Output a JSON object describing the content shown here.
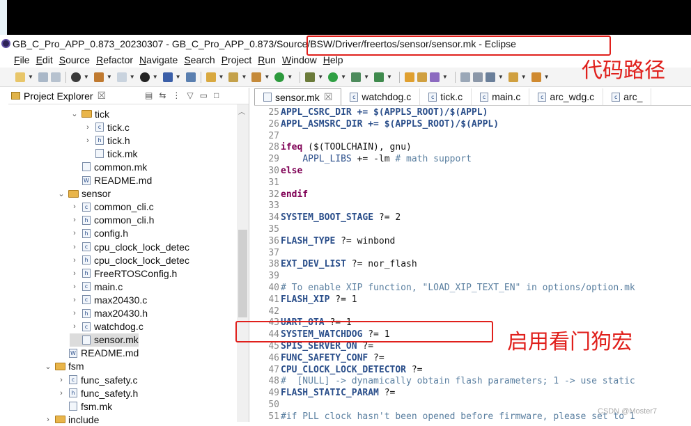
{
  "window": {
    "title": "GB_C_Pro_APP_0.873_20230307 - GB_C_Pro_APP_0.873/Source/BSW/Driver/freertos/sensor/sensor.mk - Eclipse"
  },
  "menu": [
    "File",
    "Edit",
    "Source",
    "Refactor",
    "Navigate",
    "Search",
    "Project",
    "Run",
    "Window",
    "Help"
  ],
  "explorer": {
    "title": "Project Explorer",
    "close": "☒",
    "tree": [
      {
        "label": "tick",
        "kind": "folder",
        "indent": 2,
        "expanded": true
      },
      {
        "label": "tick.c",
        "kind": "c",
        "indent": 3,
        "expanded": false
      },
      {
        "label": "tick.h",
        "kind": "h",
        "indent": 3,
        "expanded": false
      },
      {
        "label": "tick.mk",
        "kind": "mk",
        "indent": 3,
        "expanded": null
      },
      {
        "label": "common.mk",
        "kind": "mk",
        "indent": 2,
        "expanded": null
      },
      {
        "label": "README.md",
        "kind": "md",
        "indent": 2,
        "expanded": null
      },
      {
        "label": "sensor",
        "kind": "folder",
        "indent": 1,
        "expanded": true
      },
      {
        "label": "common_cli.c",
        "kind": "c",
        "indent": 2,
        "expanded": false
      },
      {
        "label": "common_cli.h",
        "kind": "h",
        "indent": 2,
        "expanded": false
      },
      {
        "label": "config.h",
        "kind": "h",
        "indent": 2,
        "expanded": false
      },
      {
        "label": "cpu_clock_lock_detec",
        "kind": "c",
        "indent": 2,
        "expanded": false
      },
      {
        "label": "cpu_clock_lock_detec",
        "kind": "h",
        "indent": 2,
        "expanded": false
      },
      {
        "label": "FreeRTOSConfig.h",
        "kind": "h",
        "indent": 2,
        "expanded": false
      },
      {
        "label": "main.c",
        "kind": "c",
        "indent": 2,
        "expanded": false
      },
      {
        "label": "max20430.c",
        "kind": "c",
        "indent": 2,
        "expanded": false
      },
      {
        "label": "max20430.h",
        "kind": "h",
        "indent": 2,
        "expanded": false
      },
      {
        "label": "watchdog.c",
        "kind": "c",
        "indent": 2,
        "expanded": false
      },
      {
        "label": "sensor.mk",
        "kind": "mk",
        "indent": 2,
        "expanded": null,
        "selected": true
      },
      {
        "label": "README.md",
        "kind": "md",
        "indent": 1,
        "expanded": null
      },
      {
        "label": "fsm",
        "kind": "folder",
        "indent": 0,
        "expanded": true
      },
      {
        "label": "func_safety.c",
        "kind": "c",
        "indent": 1,
        "expanded": false
      },
      {
        "label": "func_safety.h",
        "kind": "h",
        "indent": 1,
        "expanded": false
      },
      {
        "label": "fsm.mk",
        "kind": "mk",
        "indent": 1,
        "expanded": null
      },
      {
        "label": "include",
        "kind": "folder",
        "indent": 0,
        "expanded": false
      }
    ]
  },
  "editor": {
    "tabs": [
      {
        "label": "sensor.mk",
        "active": true,
        "close": "☒"
      },
      {
        "label": "watchdog.c",
        "active": false
      },
      {
        "label": "tick.c",
        "active": false
      },
      {
        "label": "main.c",
        "active": false
      },
      {
        "label": "arc_wdg.c",
        "active": false
      },
      {
        "label": "arc_",
        "active": false
      }
    ],
    "lines": [
      {
        "n": "25",
        "t": "APPL_CSRC_DIR += $(APPLS_ROOT)/$(APPL)",
        "style": "var"
      },
      {
        "n": "26",
        "t": "APPL_ASMSRC_DIR += $(APPLS_ROOT)/$(APPL)",
        "style": "var"
      },
      {
        "n": "27",
        "t": "",
        "style": "plain"
      },
      {
        "n": "28",
        "t": "ifeq ($(TOOLCHAIN), gnu)",
        "style": "ifeq"
      },
      {
        "n": "29",
        "t": "    APPL_LIBS += -lm # math support",
        "style": "libs"
      },
      {
        "n": "30",
        "t": "else",
        "style": "kw"
      },
      {
        "n": "31",
        "t": "",
        "style": "plain"
      },
      {
        "n": "32",
        "t": "endif",
        "style": "kw"
      },
      {
        "n": "33",
        "t": "",
        "style": "plain"
      },
      {
        "n": "34",
        "t": "SYSTEM_BOOT_STAGE ?= 2",
        "style": "assign"
      },
      {
        "n": "35",
        "t": "",
        "style": "plain"
      },
      {
        "n": "36",
        "t": "FLASH_TYPE ?= winbond",
        "style": "assign"
      },
      {
        "n": "37",
        "t": "",
        "style": "plain"
      },
      {
        "n": "38",
        "t": "EXT_DEV_LIST ?= nor_flash",
        "style": "assign"
      },
      {
        "n": "39",
        "t": "",
        "style": "plain"
      },
      {
        "n": "40",
        "t": "# To enable XIP function, \"LOAD_XIP_TEXT_EN\" in options/option.mk",
        "style": "comment"
      },
      {
        "n": "41",
        "t": "FLASH_XIP ?= 1",
        "style": "assign"
      },
      {
        "n": "42",
        "t": "",
        "style": "plain"
      },
      {
        "n": "43",
        "t": "UART_OTA ?= 1",
        "style": "assign"
      },
      {
        "n": "44",
        "t": "SYSTEM_WATCHDOG ?= 1",
        "style": "assign"
      },
      {
        "n": "45",
        "t": "SPIS_SERVER_ON ?=",
        "style": "assign"
      },
      {
        "n": "46",
        "t": "FUNC_SAFETY_CONF ?=",
        "style": "assign"
      },
      {
        "n": "47",
        "t": "CPU_CLOCK_LOCK_DETECTOR ?=",
        "style": "assign"
      },
      {
        "n": "48",
        "t": "#  [NULL] -> dynamically obtain flash parameters; 1 -> use static",
        "style": "comment"
      },
      {
        "n": "49",
        "t": "FLASH_STATIC_PARAM ?=",
        "style": "assign"
      },
      {
        "n": "50",
        "t": "",
        "style": "plain"
      },
      {
        "n": "51",
        "t": "#if PLL clock hasn't been opened before firmware, please set to 1",
        "style": "comment"
      }
    ]
  },
  "annotations": {
    "path_label": "代码路径",
    "watchdog_label": "启用看门狗宏"
  },
  "watermark": "CSDN @Moster7",
  "colors": {
    "annotation_red": "#e0201c",
    "keyword": "#7f0055",
    "variable": "#2a4e8a",
    "comment": "#5a7fa0"
  }
}
